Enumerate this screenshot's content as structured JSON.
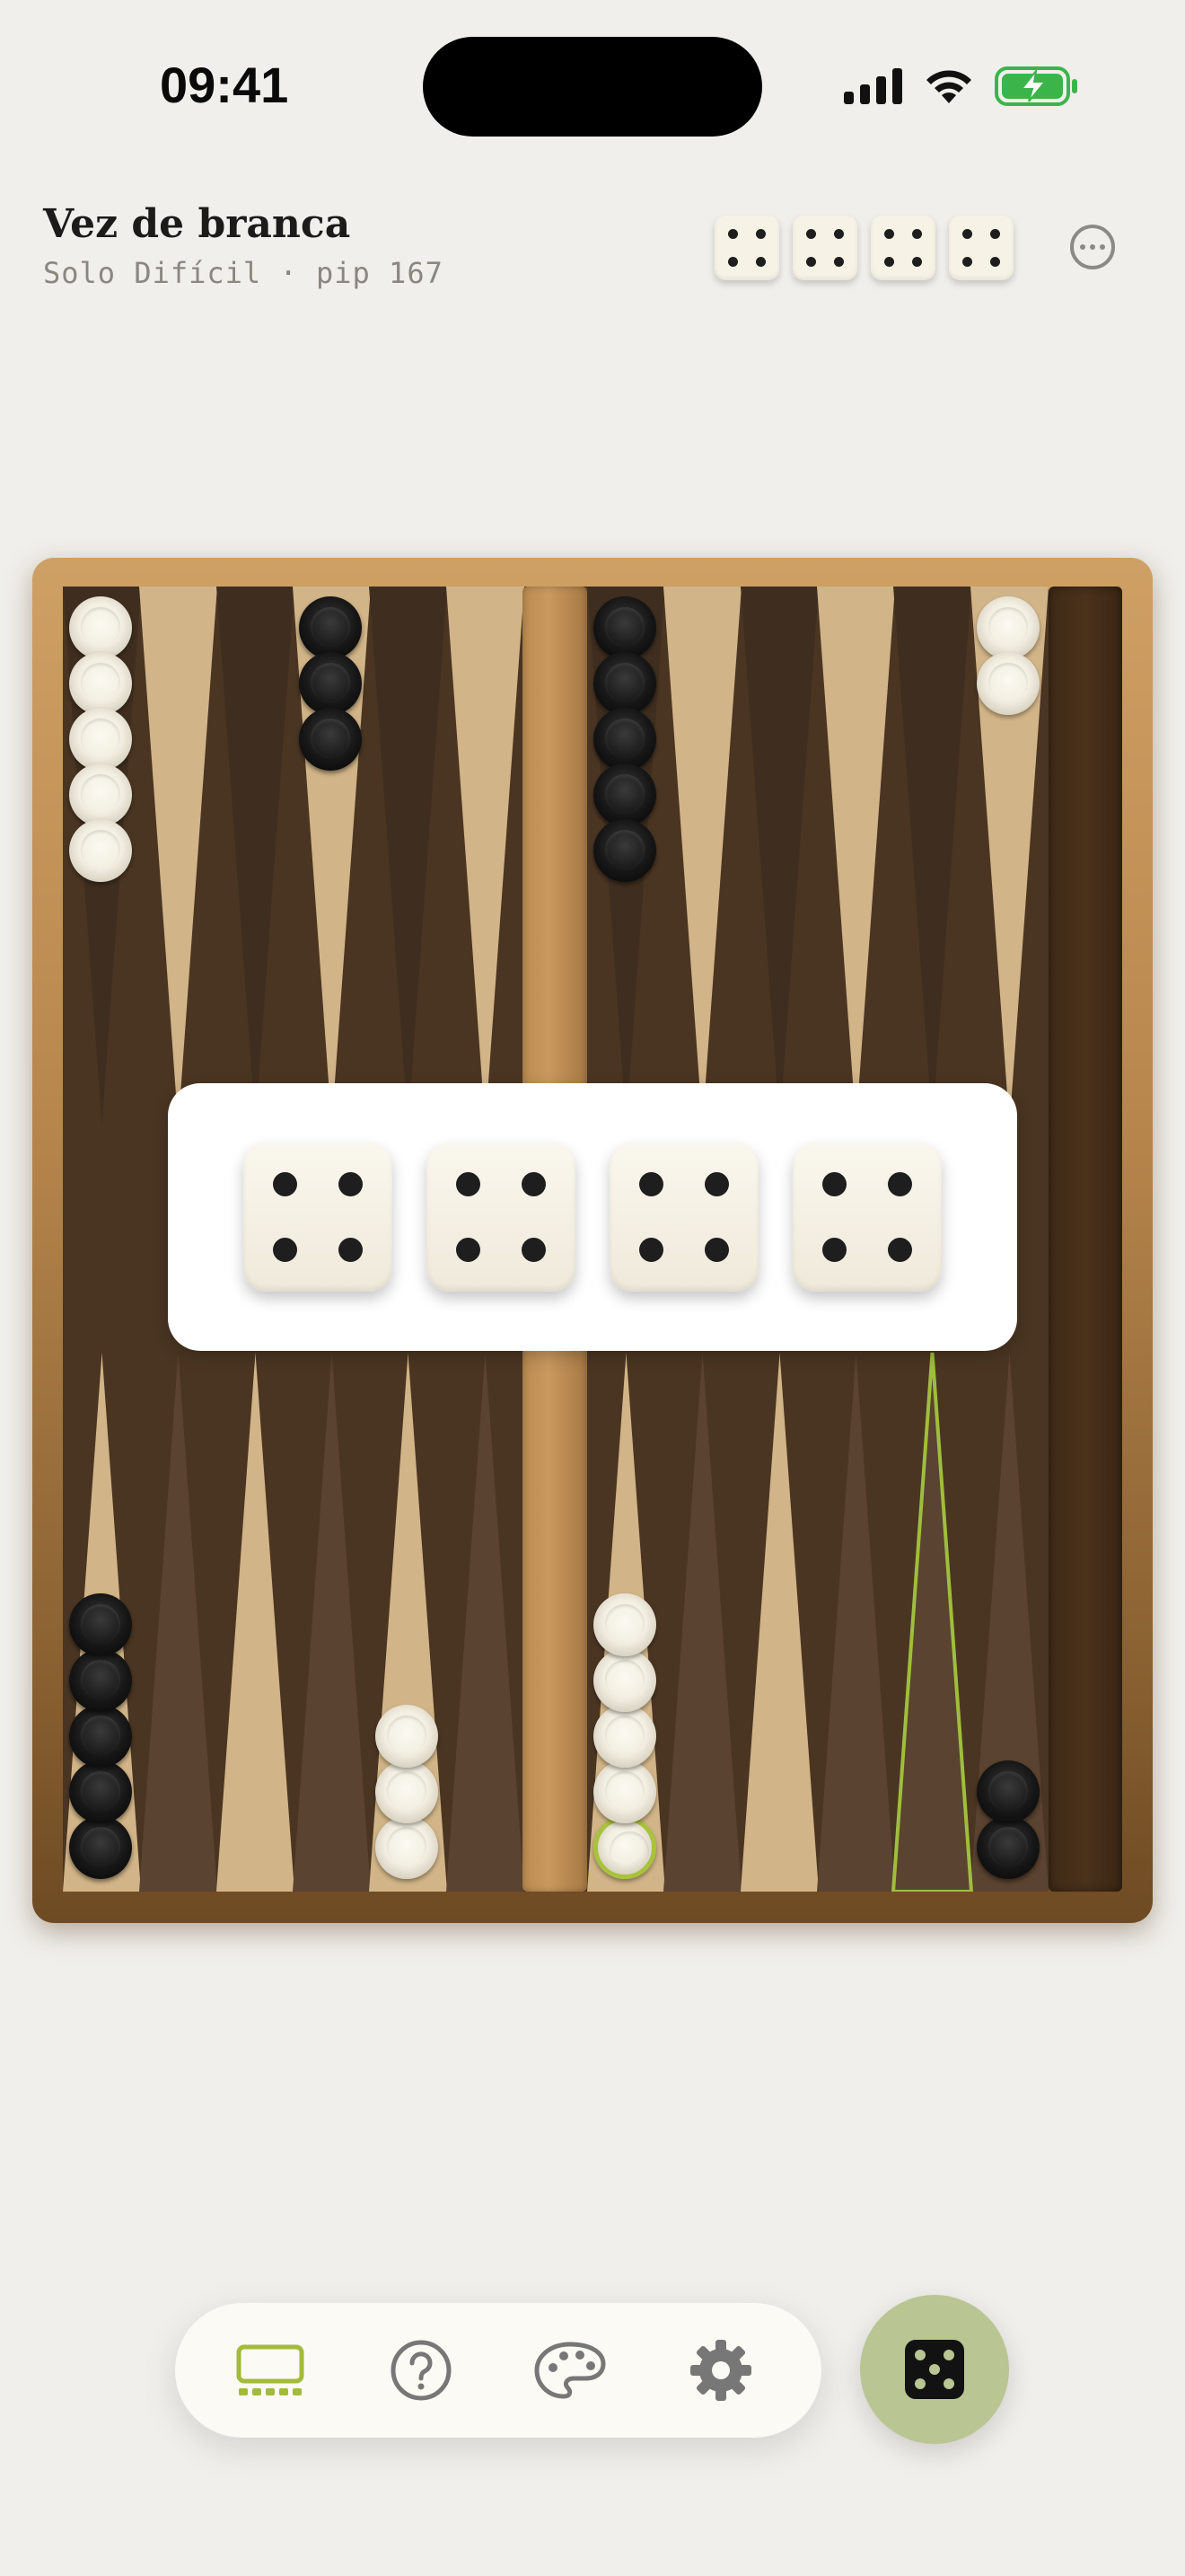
{
  "status_bar": {
    "time": "09:41"
  },
  "header": {
    "title": "Vez de branca",
    "subtitle": "Solo Difícil · pip 167",
    "dice": [
      4,
      4,
      4,
      4
    ],
    "more_icon": "ellipsis-circle-icon"
  },
  "board": {
    "top_left": [
      {
        "color": "white",
        "count": 5
      },
      null,
      null,
      {
        "color": "black",
        "count": 3
      },
      null,
      null
    ],
    "top_right": [
      {
        "color": "black",
        "count": 5
      },
      null,
      null,
      null,
      null,
      {
        "color": "white",
        "count": 2
      }
    ],
    "bottom_left": [
      {
        "color": "black",
        "count": 5
      },
      null,
      null,
      null,
      {
        "color": "white",
        "count": 3
      },
      null
    ],
    "bottom_right": [
      {
        "color": "white",
        "count": 5
      },
      null,
      null,
      null,
      null,
      {
        "color": "black",
        "count": 2
      }
    ],
    "colors": {
      "light_point": "#d1b487",
      "dark_point": "#5a4330",
      "highlight": "#9fbe3c"
    }
  },
  "dice_overlay": {
    "values": [
      4,
      4,
      4,
      4
    ]
  },
  "bottom_nav": {
    "items": [
      {
        "name": "board",
        "icon": "board-icon",
        "active": true
      },
      {
        "name": "help",
        "icon": "question-circle-icon",
        "active": false
      },
      {
        "name": "themes",
        "icon": "palette-icon",
        "active": false
      },
      {
        "name": "settings",
        "icon": "gear-icon",
        "active": false
      }
    ],
    "roll_button": {
      "icon": "die-five-icon",
      "value": 5
    }
  }
}
